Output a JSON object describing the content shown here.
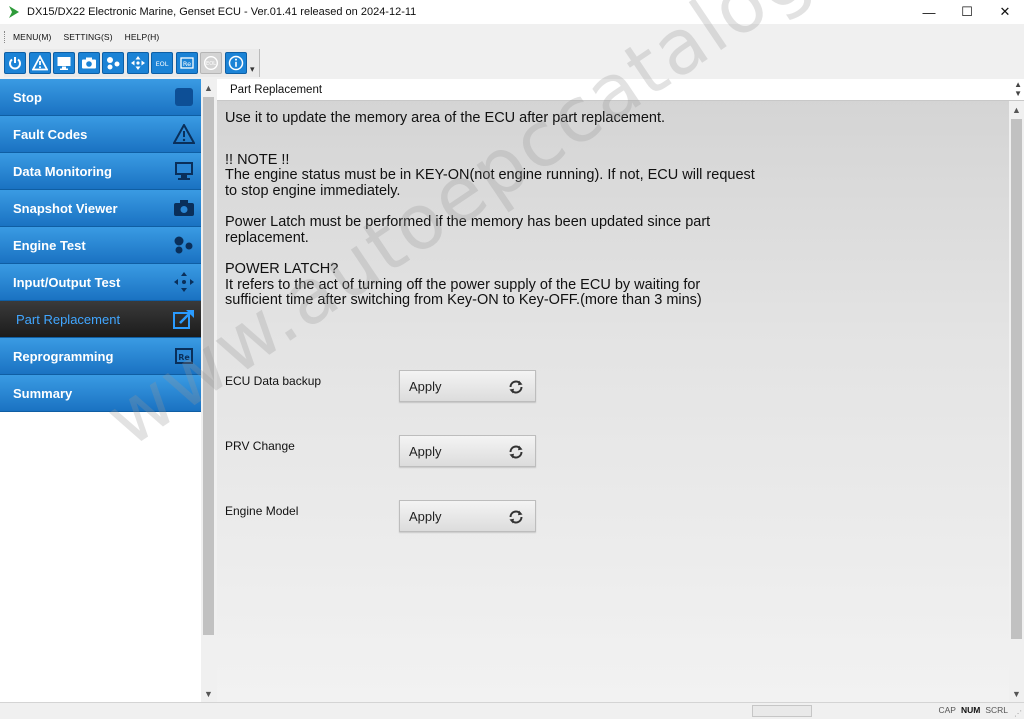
{
  "window": {
    "title": "DX15/DX22 Electronic Marine, Genset ECU - Ver.01.41 released on 2024-12-11",
    "minimize": "—",
    "maximize": "☐",
    "close": "✕"
  },
  "menu": {
    "items": [
      "MENU(M)",
      "SETTING(S)",
      "HELP(H)"
    ]
  },
  "toolbar": {
    "buttons": [
      {
        "icon": "power-icon"
      },
      {
        "icon": "warning-icon"
      },
      {
        "icon": "monitor-icon"
      },
      {
        "icon": "camera-icon"
      },
      {
        "icon": "engine-test-icon"
      },
      {
        "icon": "io-test-icon"
      },
      {
        "icon": "eol-icon",
        "text": "EOL"
      },
      {
        "icon": "reprogram-icon",
        "text": "Re"
      },
      {
        "icon": "disabled-icon",
        "text": "EOL",
        "disabled": true
      },
      {
        "icon": "info-icon",
        "text": "i"
      }
    ]
  },
  "sidebar": {
    "items": [
      {
        "label": "Stop",
        "icon": "stop-icon"
      },
      {
        "label": "Fault Codes",
        "icon": "warning-icon"
      },
      {
        "label": "Data Monitoring",
        "icon": "monitor-icon"
      },
      {
        "label": "Snapshot Viewer",
        "icon": "camera-icon"
      },
      {
        "label": "Engine Test",
        "icon": "engine-test-icon"
      },
      {
        "label": "Input/Output Test",
        "icon": "io-test-icon"
      },
      {
        "label": "Part Replacement",
        "icon": "part-replacement-icon",
        "active": true
      },
      {
        "label": "Reprogramming",
        "icon": "reprogram-icon"
      },
      {
        "label": "Summary",
        "icon": ""
      }
    ]
  },
  "panel": {
    "header": "Part Replacement",
    "intro": "Use it to update the memory area of the ECU after part replacement.",
    "note_title": "!! NOTE !!",
    "note_line1": "The engine status must be in KEY-ON(not engine running). If not, ECU will request",
    "note_line2": "to stop engine immediately.",
    "latch_line1": "Power Latch must be performed if the memory has been updated since part",
    "latch_line2": "replacement.",
    "latch_q": "POWER LATCH?",
    "latch_def1": "It refers to the act of turning off the power supply of the ECU by waiting for",
    "latch_def2": "sufficient time after switching from Key-ON to Key-OFF.(more than 3 mins)",
    "rows": [
      {
        "label": "ECU Data backup",
        "button": "Apply"
      },
      {
        "label": "PRV Change",
        "button": "Apply"
      },
      {
        "label": "Engine Model",
        "button": "Apply"
      }
    ]
  },
  "statusbar": {
    "keys": [
      {
        "label": "CAP",
        "on": false
      },
      {
        "label": "NUM",
        "on": true
      },
      {
        "label": "SCRL",
        "on": false
      }
    ]
  },
  "watermark": "www.autoepccatalog.com"
}
